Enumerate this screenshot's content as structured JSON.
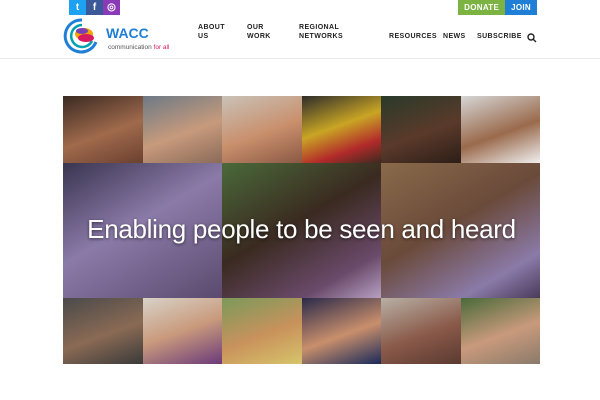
{
  "social": {
    "twitter": "t",
    "facebook": "f",
    "instagram": "◎"
  },
  "top_buttons": {
    "donate": "DONATE",
    "join": "JOIN"
  },
  "logo": {
    "name": "WACC",
    "tagline_a": "communication ",
    "tagline_b": "for all"
  },
  "nav": {
    "about_l1": "ABOUT",
    "about_l2": "US",
    "work_l1": "OUR",
    "work_l2": "WORK",
    "regional_l1": "REGIONAL",
    "regional_l2": "NETWORKS",
    "resources": "RESOURCES",
    "news": "NEWS",
    "subscribe": "SUBSCRIBE"
  },
  "hero": {
    "headline": "Enabling people to be seen and heard"
  },
  "colors": {
    "accent_blue": "#1f7fd6",
    "donate_green": "#7cb342",
    "tagline_pink": "#d81b60"
  },
  "icons": [
    "twitter-icon",
    "facebook-icon",
    "instagram-icon",
    "search-icon",
    "wacc-logo-icon"
  ]
}
